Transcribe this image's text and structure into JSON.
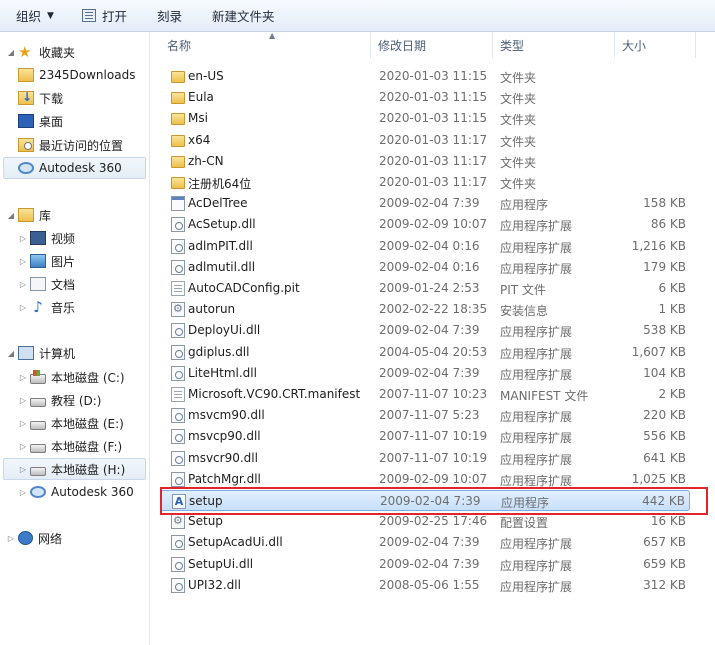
{
  "toolbar": {
    "organize": "组织",
    "open": "打开",
    "burn": "刻录",
    "new_folder": "新建文件夹"
  },
  "nav": {
    "favorites": "收藏夹",
    "favorites_items": [
      "2345Downloads",
      "下载",
      "桌面",
      "最近访问的位置",
      "Autodesk 360"
    ],
    "libraries": "库",
    "library_items": [
      "视频",
      "图片",
      "文档",
      "音乐"
    ],
    "computer": "计算机",
    "drives": [
      "本地磁盘 (C:)",
      "教程 (D:)",
      "本地磁盘 (E:)",
      "本地磁盘 (F:)",
      "本地磁盘 (H:)",
      "Autodesk 360"
    ],
    "network": "网络"
  },
  "columns": {
    "name": "名称",
    "date": "修改日期",
    "type": "类型",
    "size": "大小"
  },
  "files": [
    {
      "icon": "folder-icon",
      "name": "en-US",
      "date": "2020-01-03 11:15",
      "type": "文件夹",
      "size": ""
    },
    {
      "icon": "folder-icon",
      "name": "Eula",
      "date": "2020-01-03 11:15",
      "type": "文件夹",
      "size": ""
    },
    {
      "icon": "folder-icon",
      "name": "Msi",
      "date": "2020-01-03 11:15",
      "type": "文件夹",
      "size": ""
    },
    {
      "icon": "folder-icon",
      "name": "x64",
      "date": "2020-01-03 11:17",
      "type": "文件夹",
      "size": ""
    },
    {
      "icon": "folder-icon",
      "name": "zh-CN",
      "date": "2020-01-03 11:17",
      "type": "文件夹",
      "size": ""
    },
    {
      "icon": "folder-icon",
      "name": "注册机64位",
      "date": "2020-01-03 11:17",
      "type": "文件夹",
      "size": ""
    },
    {
      "icon": "exe-icon",
      "name": "AcDelTree",
      "date": "2009-02-04 7:39",
      "type": "应用程序",
      "size": "158 KB"
    },
    {
      "icon": "dll-icon",
      "name": "AcSetup.dll",
      "date": "2009-02-09 10:07",
      "type": "应用程序扩展",
      "size": "86 KB"
    },
    {
      "icon": "dll-icon",
      "name": "adlmPIT.dll",
      "date": "2009-02-04 0:16",
      "type": "应用程序扩展",
      "size": "1,216 KB"
    },
    {
      "icon": "dll-icon",
      "name": "adlmutil.dll",
      "date": "2009-02-04 0:16",
      "type": "应用程序扩展",
      "size": "179 KB"
    },
    {
      "icon": "document-icon",
      "name": "AutoCADConfig.pit",
      "date": "2009-01-24 2:53",
      "type": "PIT 文件",
      "size": "6 KB"
    },
    {
      "icon": "settings-file-icon",
      "name": "autorun",
      "date": "2002-02-22 18:35",
      "type": "安装信息",
      "size": "1 KB"
    },
    {
      "icon": "dll-icon",
      "name": "DeployUi.dll",
      "date": "2009-02-04 7:39",
      "type": "应用程序扩展",
      "size": "538 KB"
    },
    {
      "icon": "dll-icon",
      "name": "gdiplus.dll",
      "date": "2004-05-04 20:53",
      "type": "应用程序扩展",
      "size": "1,607 KB"
    },
    {
      "icon": "dll-icon",
      "name": "LiteHtml.dll",
      "date": "2009-02-04 7:39",
      "type": "应用程序扩展",
      "size": "104 KB"
    },
    {
      "icon": "document-icon",
      "name": "Microsoft.VC90.CRT.manifest",
      "date": "2007-11-07 10:23",
      "type": "MANIFEST 文件",
      "size": "2 KB"
    },
    {
      "icon": "dll-icon",
      "name": "msvcm90.dll",
      "date": "2007-11-07 5:23",
      "type": "应用程序扩展",
      "size": "220 KB"
    },
    {
      "icon": "dll-icon",
      "name": "msvcp90.dll",
      "date": "2007-11-07 10:19",
      "type": "应用程序扩展",
      "size": "556 KB"
    },
    {
      "icon": "dll-icon",
      "name": "msvcr90.dll",
      "date": "2007-11-07 10:19",
      "type": "应用程序扩展",
      "size": "641 KB"
    },
    {
      "icon": "dll-icon",
      "name": "PatchMgr.dll",
      "date": "2009-02-09 10:07",
      "type": "应用程序扩展",
      "size": "1,025 KB"
    },
    {
      "icon": "setup-exe-icon",
      "name": "setup",
      "date": "2009-02-04 7:39",
      "type": "应用程序",
      "size": "442 KB",
      "selected": true
    },
    {
      "icon": "settings-file-icon",
      "name": "Setup",
      "date": "2009-02-25 17:46",
      "type": "配置设置",
      "size": "16 KB"
    },
    {
      "icon": "dll-icon",
      "name": "SetupAcadUi.dll",
      "date": "2009-02-04 7:39",
      "type": "应用程序扩展",
      "size": "657 KB"
    },
    {
      "icon": "dll-icon",
      "name": "SetupUi.dll",
      "date": "2009-02-04 7:39",
      "type": "应用程序扩展",
      "size": "659 KB"
    },
    {
      "icon": "dll-icon",
      "name": "UPI32.dll",
      "date": "2008-05-06 1:55",
      "type": "应用程序扩展",
      "size": "312 KB"
    }
  ],
  "colors": {
    "highlight_box": "#e0262a",
    "selection": "#c7dff9"
  }
}
